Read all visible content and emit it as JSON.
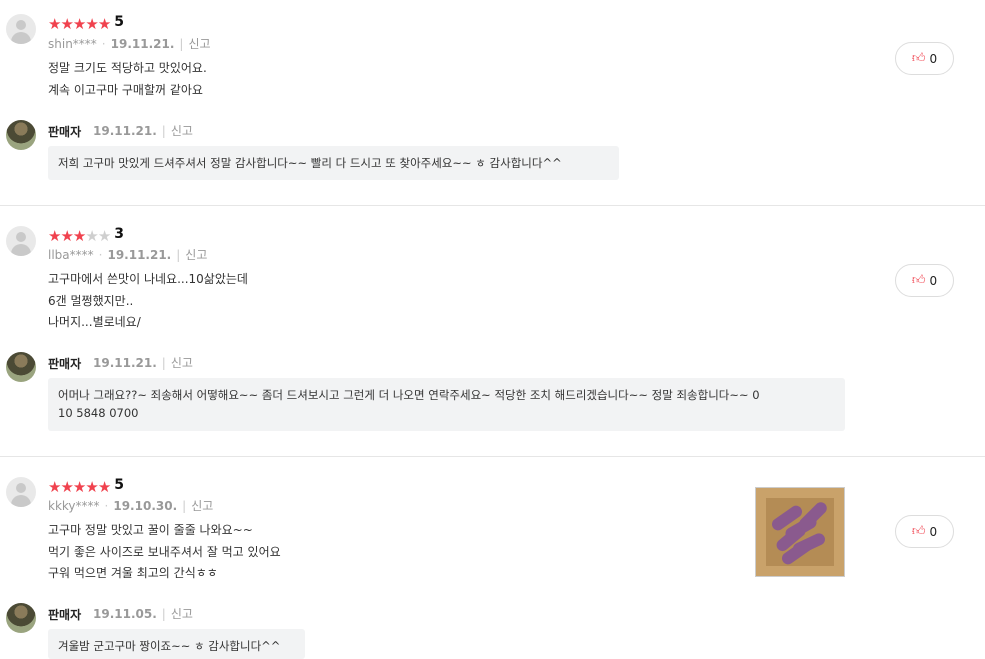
{
  "reviews": [
    {
      "rating": 5,
      "score": "5",
      "user": "shin****",
      "date": "19.11.21.",
      "report": "신고",
      "lines": [
        "정말 크기도 적당하고 맛있어요.",
        "계속 이고구마 구매할꺼 같아요"
      ],
      "likes": "0",
      "seller": {
        "name": "판매자",
        "date": "19.11.21.",
        "report": "신고",
        "lines": [
          "저희 고구마 맛있게 드셔주셔서 정말 감사합니다~~ 빨리 다 드시고 또 찾아주세요~~ ㅎ 감사합니다^^"
        ]
      }
    },
    {
      "rating": 3,
      "score": "3",
      "user": "llba****",
      "date": "19.11.21.",
      "report": "신고",
      "lines": [
        "고구마에서 쓴맛이 나네요...10삶았는데",
        "6갠 멀쩡했지만..",
        "나머지...별로네요/"
      ],
      "likes": "0",
      "seller": {
        "name": "판매자",
        "date": "19.11.21.",
        "report": "신고",
        "lines": [
          "어머나 그래요??~ 죄송해서 어떻해요~~ 좀더 드셔보시고 그런게 더 나오면 연락주세요~ 적당한 조치 해드리겠습니다~~ 정말 죄송합니다~~ 0",
          "10 5848 0700"
        ]
      }
    },
    {
      "rating": 5,
      "score": "5",
      "user": "kkky****",
      "date": "19.10.30.",
      "report": "신고",
      "lines": [
        "고구마 정말 맛있고 꿀이 줄줄 나와요~~",
        "먹기 좋은 사이즈로 보내주셔서 잘 먹고 있어요",
        "구워 먹으면 겨울 최고의 간식ㅎㅎ"
      ],
      "likes": "0",
      "seller": {
        "name": "판매자",
        "date": "19.11.05.",
        "report": "신고",
        "lines": [
          "겨울밤 군고구마 짱이죠~~ ㅎ 감사합니다^^"
        ]
      }
    }
  ],
  "icons": {
    "star": "star-icon",
    "thumb": "thumbs-up-icon"
  },
  "colors": {
    "star_on": "#f0424e",
    "star_off": "#cfcfcf",
    "reply_bg": "#f2f3f4"
  }
}
